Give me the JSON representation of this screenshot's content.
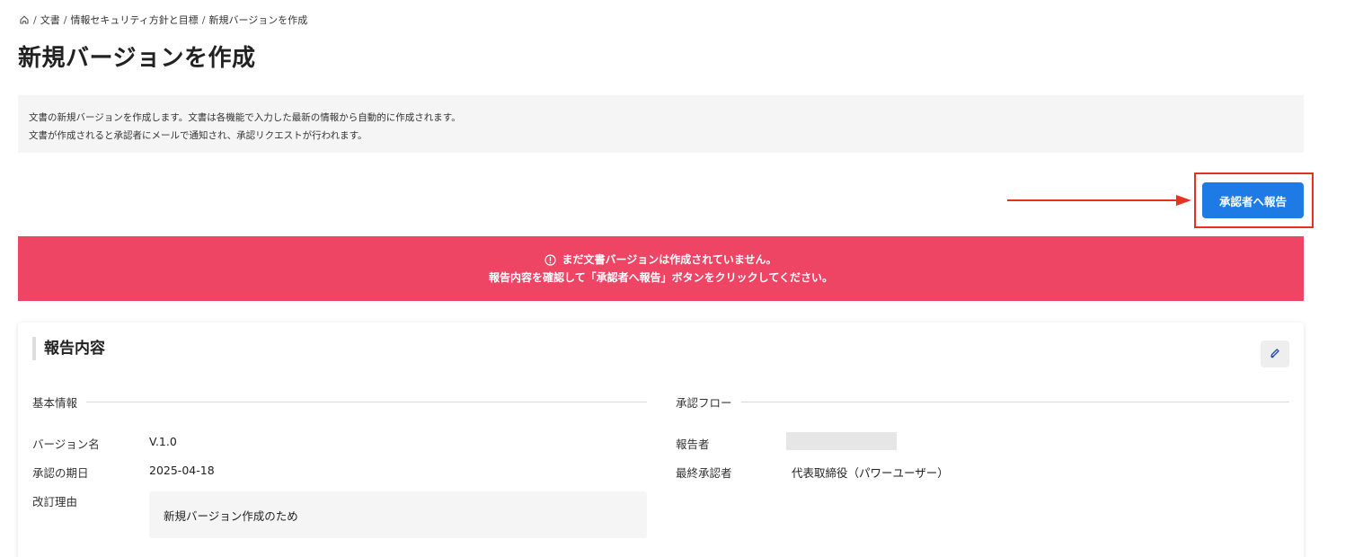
{
  "breadcrumb": {
    "home_icon": "home-icon",
    "items": [
      "文書",
      "情報セキュリティ方針と目標",
      "新規バージョンを作成"
    ],
    "separator": "/"
  },
  "page": {
    "title": "新規バージョンを作成"
  },
  "info": {
    "line1": "文書の新規バージョンを作成します。文書は各機能で入力した最新の情報から自動的に作成されます。",
    "line2": "文書が作成されると承認者にメールで通知され、承認リクエストが行われます。"
  },
  "actions": {
    "report_button_label": "承認者へ報告"
  },
  "alert": {
    "icon": "alert-circle-icon",
    "line1": "まだ文書バージョンは作成されていません。",
    "line2": "報告内容を確認して「承認者へ報告」ボタンをクリックしてください。",
    "color": "#ef4565"
  },
  "card": {
    "title": "報告内容",
    "edit_icon": "pencil-icon",
    "basic_info": {
      "header": "基本情報",
      "version_name_label": "バージョン名",
      "version_name_value": "V.1.0",
      "due_date_label": "承認の期日",
      "due_date_value": "2025-04-18",
      "reason_label": "改訂理由",
      "reason_value": "新規バージョン作成のため"
    },
    "approval_flow": {
      "header": "承認フロー",
      "reporter_label": "報告者",
      "final_approver_label": "最終承認者",
      "final_approver_value": "代表取締役（パワーユーザー）"
    }
  },
  "colors": {
    "primary": "#1e7be6",
    "annotation": "#e5331f",
    "alert": "#ef4565"
  }
}
